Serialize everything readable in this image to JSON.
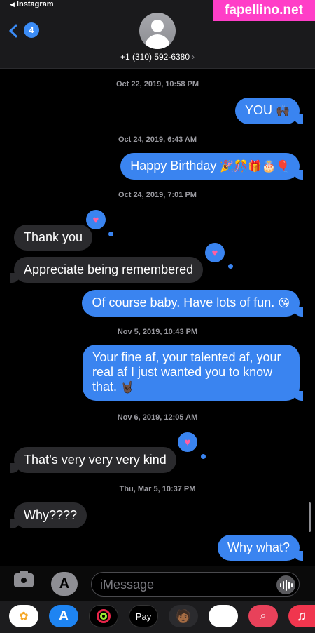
{
  "status": {
    "back_app": "Instagram"
  },
  "header": {
    "back_count": "4",
    "contact": "+1 (310) 592-6380",
    "contact_chevron": "›"
  },
  "watermark": "fapellino.net",
  "messages": [
    {
      "type": "timestamp",
      "text": "Oct 22, 2019, 10:58 PM"
    },
    {
      "type": "sent",
      "text": "YOU",
      "emoji": "🙌🏿"
    },
    {
      "type": "timestamp",
      "text": "Oct 24, 2019, 6:43 AM"
    },
    {
      "type": "sent",
      "text": "Happy Birthday",
      "emoji": "🎉🎊🎁🎂🎈"
    },
    {
      "type": "timestamp",
      "text": "Oct 24, 2019, 7:01 PM"
    },
    {
      "type": "received",
      "text": "Thank you",
      "tapback": "heart"
    },
    {
      "type": "received",
      "text": "Appreciate being remembered",
      "tapback": "heart"
    },
    {
      "type": "sent",
      "text": "Of course baby. Have lots of fun.",
      "emoji": "😘"
    },
    {
      "type": "timestamp",
      "text": "Nov 5, 2019, 10:43 PM"
    },
    {
      "type": "sent",
      "line1": "Your fine af, your talented af, your",
      "line2": "real af I just wanted you to know",
      "line3": "that.",
      "emoji": "🤘🏿"
    },
    {
      "type": "timestamp",
      "text": "Nov 6, 2019, 12:05 AM"
    },
    {
      "type": "received",
      "text": "That’s very very very kind",
      "tapback": "heart"
    },
    {
      "type": "timestamp",
      "text": "Thu, Mar 5, 10:37 PM"
    },
    {
      "type": "received",
      "text": "Why????"
    },
    {
      "type": "sent",
      "text": "Why what?"
    }
  ],
  "input": {
    "placeholder": "iMessage"
  },
  "app_tray": {
    "apple_pay_label": "Pay",
    "apple_pay_glyph": "",
    "apps": [
      "photos",
      "app-store",
      "fitness",
      "apple-pay",
      "memoji",
      "memoji-stickers",
      "search-images",
      "music"
    ]
  },
  "colors": {
    "sent_bubble": "#3a84f0",
    "received_bubble": "#2a2a2d",
    "accent": "#3b8cf6",
    "watermark_bg": "#ff3ec7"
  }
}
